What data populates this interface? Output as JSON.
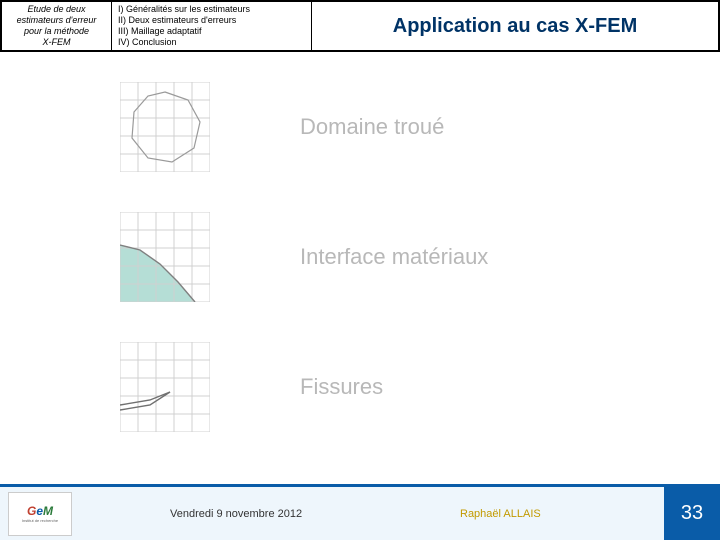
{
  "header": {
    "left_line1": "Etude de deux",
    "left_line2": "estimateurs d'erreur",
    "left_line3": "pour la méthode",
    "left_line4": "X-FEM",
    "toc_i": "I) Généralités sur les estimateurs",
    "toc_ii": "II) Deux estimateurs d'erreurs",
    "toc_iii": "III) Maillage adaptatif",
    "toc_iv": "IV) Conclusion",
    "title": "Application au cas X-FEM"
  },
  "rows": {
    "r1": "Domaine troué",
    "r2": "Interface matériaux",
    "r3": "Fissures"
  },
  "footer": {
    "date": "Vendredi 9 novembre 2012",
    "author": "Raphaël ALLAIS",
    "page": "33"
  }
}
